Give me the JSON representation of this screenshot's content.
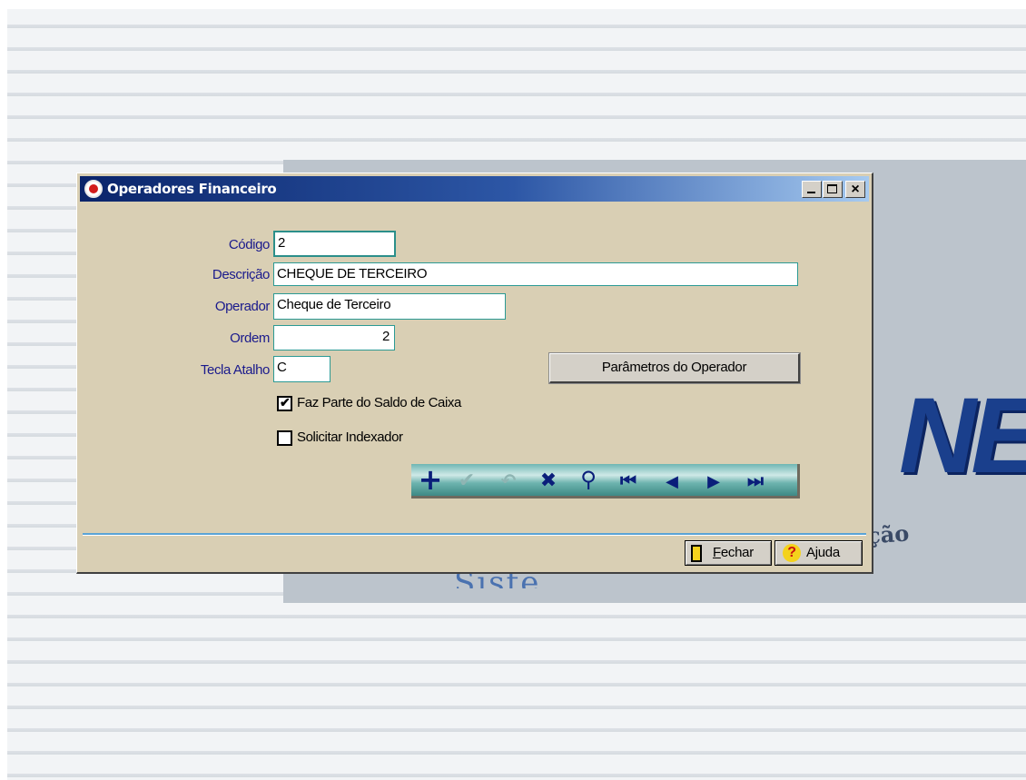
{
  "background": {
    "logo_text": "NET",
    "logo_sub": "ção",
    "logo_sys": "Siste"
  },
  "window": {
    "title": "Operadores Financeiro",
    "title_buttons": {
      "minimize": "_",
      "maximize": "□",
      "close": "×"
    }
  },
  "form": {
    "codigo": {
      "label": "Código",
      "value": "2"
    },
    "descricao": {
      "label": "Descrição",
      "value": "CHEQUE DE TERCEIRO"
    },
    "operador": {
      "label": "Operador",
      "value": "Cheque de Terceiro"
    },
    "ordem": {
      "label": "Ordem",
      "value": "2"
    },
    "tecla_atalho": {
      "label": "Tecla Atalho",
      "value": "C"
    },
    "params_button": "Parâmetros do Operador",
    "faz_parte": {
      "label": "Faz Parte do Saldo de Caixa",
      "checked": true,
      "mark": "✔"
    },
    "solicitar_indexador": {
      "label": "Solicitar Indexador",
      "checked": false
    }
  },
  "navigator": {
    "add": "+",
    "confirm": "✔",
    "undo": "↶",
    "delete": "✖",
    "search": "⚲",
    "first": "⏮",
    "prior": "◀",
    "next": "▶",
    "last": "⏭"
  },
  "footer": {
    "fechar_first": "F",
    "fechar_rest": "echar",
    "ajuda": "Ajuda",
    "help_icon": "?"
  },
  "colors": {
    "title_gradient_start": "#0a246a",
    "title_gradient_end": "#a6caf0",
    "window_bg": "#d9cfb4",
    "label_color": "#1a1a8c",
    "field_border": "#2b9a94",
    "navbar_teal": "#6db3ae",
    "nav_icon": "#0a1e7a"
  }
}
